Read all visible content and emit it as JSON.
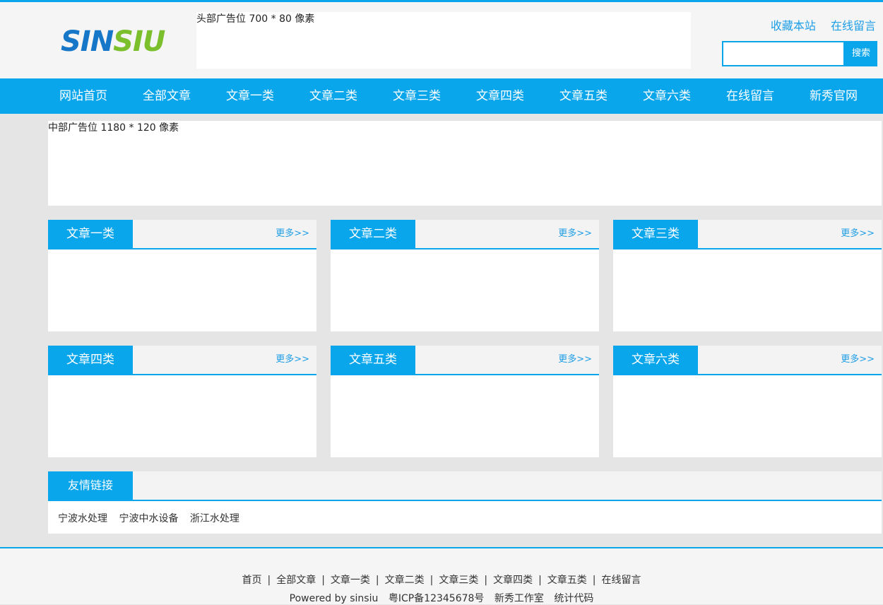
{
  "header": {
    "logo_part1": "SIN",
    "logo_part2": "SIU",
    "ad_text": "头部广告位 700 * 80 像素",
    "links": [
      "收藏本站",
      "在线留言"
    ],
    "search_placeholder": "",
    "search_button": "搜索"
  },
  "nav": {
    "items": [
      "网站首页",
      "全部文章",
      "文章一类",
      "文章二类",
      "文章三类",
      "文章四类",
      "文章五类",
      "文章六类",
      "在线留言",
      "新秀官网"
    ]
  },
  "middle_ad": {
    "text": "中部广告位 1180 * 120 像素"
  },
  "panels": [
    {
      "title": "文章一类",
      "more": "更多>>"
    },
    {
      "title": "文章二类",
      "more": "更多>>"
    },
    {
      "title": "文章三类",
      "more": "更多>>"
    },
    {
      "title": "文章四类",
      "more": "更多>>"
    },
    {
      "title": "文章五类",
      "more": "更多>>"
    },
    {
      "title": "文章六类",
      "more": "更多>>"
    }
  ],
  "friend_links": {
    "title": "友情链接",
    "items": [
      "宁波水处理",
      "宁波中水设备",
      "浙江水处理"
    ]
  },
  "footer": {
    "nav": [
      "首页",
      "全部文章",
      "文章一类",
      "文章二类",
      "文章三类",
      "文章四类",
      "文章五类",
      "在线留言"
    ],
    "separator": "|",
    "info": [
      "Powered by sinsiu",
      "粤ICP备12345678号",
      "新秀工作室",
      "统计代码"
    ]
  },
  "colors": {
    "accent": "#0aa6ec",
    "logo_blue": "#1677c8",
    "logo_green": "#7cbf2c",
    "link_blue": "#1e9ee6"
  }
}
